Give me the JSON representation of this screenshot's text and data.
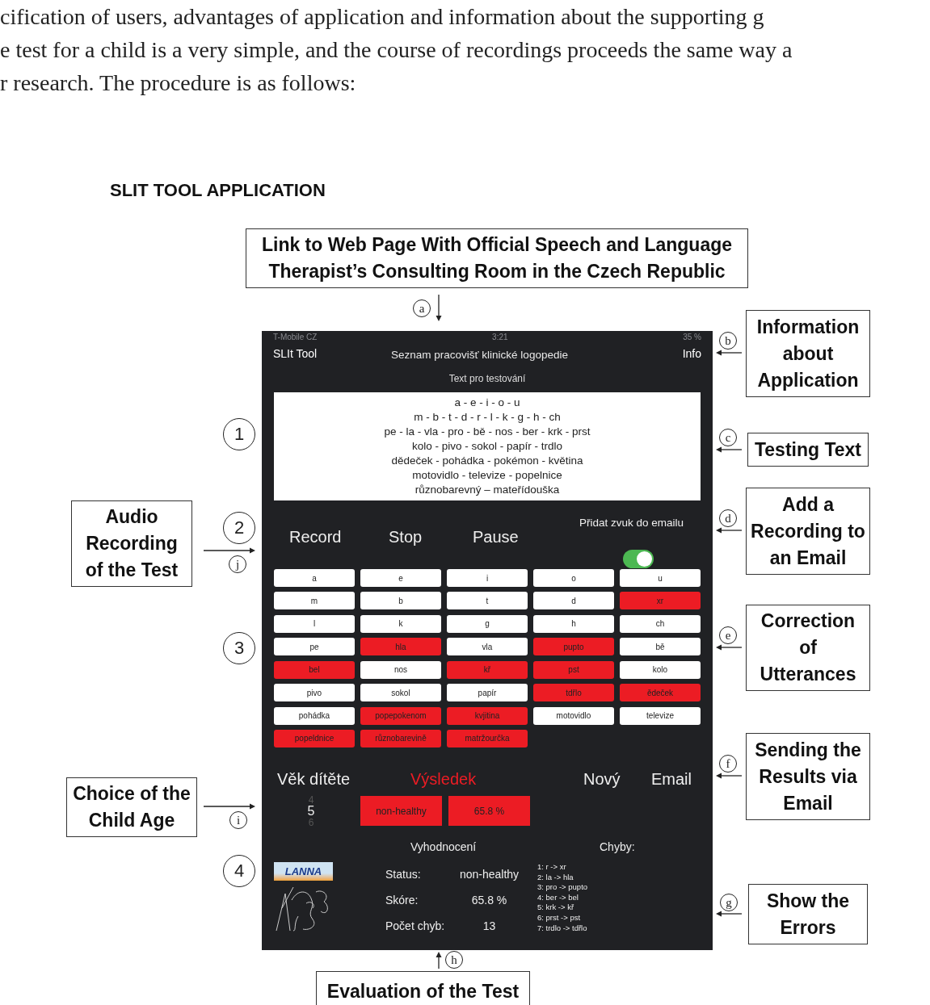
{
  "body_text": [
    "cification of users, advantages of application and information about the supporting g",
    "e test for a child is a very simple, and the course of recordings proceeds the same way a",
    "r research. The procedure is as follows:"
  ],
  "figure": {
    "title": "SLIT TOOL APPLICATION",
    "top_callout": {
      "marker": "a",
      "text": "Link to Web Page With Official Speech and Language Therapist’s Consulting Room in the Czech Republic"
    },
    "right_callouts": [
      {
        "marker": "b",
        "text": "Information about Application"
      },
      {
        "marker": "c",
        "text": "Testing Text"
      },
      {
        "marker": "d",
        "text": "Add a Recording to an Email"
      },
      {
        "marker": "e",
        "text": "Correction of Utterances"
      },
      {
        "marker": "f",
        "text": "Sending the Results via Email"
      },
      {
        "marker": "g",
        "text": "Show the Errors"
      }
    ],
    "left_callouts": [
      {
        "marker": "j",
        "text": "Audio Recording of the Test"
      },
      {
        "marker": "i",
        "text": "Choice of the Child Age"
      }
    ],
    "numbers": [
      "1",
      "2",
      "3",
      "4"
    ],
    "bottom_callout": {
      "marker": "h",
      "text": "Evaluation of the Test"
    },
    "app": {
      "status_bar": {
        "carrier": "T-Mobile CZ",
        "time": "3:21",
        "battery": "35 %"
      },
      "nav": {
        "left": "SLIt Tool",
        "title": "Seznam pracovišť klinické logopedie",
        "right": "Info"
      },
      "test_text": {
        "label": "Text pro testování",
        "lines": [
          "a - e - i - o - u",
          "m - b - t - d - r - l - k - g - h - ch",
          "pe - la - vla - pro - bě - nos - ber - krk - prst",
          "kolo - pivo - sokol - papír - trdlo",
          "dědeček - pohádka - pokémon - květina",
          "motovidlo - televize - popelnice",
          "různobarevný – mateřídouška"
        ]
      },
      "controls": [
        "Record",
        "Stop",
        "Pause"
      ],
      "email_toggle": {
        "label": "Přidat zvuk do emailu",
        "on": true
      },
      "utterances": [
        {
          "text": "a",
          "error": false
        },
        {
          "text": "e",
          "error": false
        },
        {
          "text": "i",
          "error": false
        },
        {
          "text": "o",
          "error": false
        },
        {
          "text": "u",
          "error": false
        },
        {
          "text": "m",
          "error": false
        },
        {
          "text": "b",
          "error": false
        },
        {
          "text": "t",
          "error": false
        },
        {
          "text": "d",
          "error": false
        },
        {
          "text": "xr",
          "error": true
        },
        {
          "text": "l",
          "error": false
        },
        {
          "text": "k",
          "error": false
        },
        {
          "text": "g",
          "error": false
        },
        {
          "text": "h",
          "error": false
        },
        {
          "text": "ch",
          "error": false
        },
        {
          "text": "pe",
          "error": false
        },
        {
          "text": "hla",
          "error": true
        },
        {
          "text": "vla",
          "error": false
        },
        {
          "text": "pupto",
          "error": true
        },
        {
          "text": "bě",
          "error": false
        },
        {
          "text": "bel",
          "error": true
        },
        {
          "text": "nos",
          "error": false
        },
        {
          "text": "kř",
          "error": true
        },
        {
          "text": "pst",
          "error": true
        },
        {
          "text": "kolo",
          "error": false
        },
        {
          "text": "pivo",
          "error": false
        },
        {
          "text": "sokol",
          "error": false
        },
        {
          "text": "papír",
          "error": false
        },
        {
          "text": "tdřlo",
          "error": true
        },
        {
          "text": "ědeček",
          "error": true
        },
        {
          "text": "pohádka",
          "error": false
        },
        {
          "text": "popepokenom",
          "error": true
        },
        {
          "text": "kvjitina",
          "error": true
        },
        {
          "text": "motovidlo",
          "error": false
        },
        {
          "text": "televize",
          "error": false
        },
        {
          "text": "popeldnice",
          "error": true
        },
        {
          "text": "různobarevině",
          "error": true
        },
        {
          "text": "matržourčka",
          "error": true
        }
      ],
      "bottom_bar": {
        "age_label": "Věk dítěte",
        "result_label": "Výsledek",
        "new": "Nový",
        "email": "Email"
      },
      "age_picker": [
        {
          "value": "4",
          "selected": false
        },
        {
          "value": "5",
          "selected": true
        },
        {
          "value": "6",
          "selected": false
        }
      ],
      "result": [
        "non-healthy",
        "65.8 %"
      ],
      "sponsor_logo": "LANNA",
      "evaluation": {
        "title": "Vyhodnocení",
        "rows": [
          {
            "label": "Status:",
            "value": "non-healthy"
          },
          {
            "label": "Skóre:",
            "value": "65.8 %"
          },
          {
            "label": "Počet chyb:",
            "value": "13"
          }
        ]
      },
      "errors": {
        "title": "Chyby:",
        "items": [
          "1: r -> xr",
          "2: la -> hla",
          "3: pro -> pupto",
          "4: ber -> bel",
          "5: krk -> kř",
          "6: prst -> pst",
          "7: trdlo -> tdřlo"
        ]
      }
    }
  }
}
